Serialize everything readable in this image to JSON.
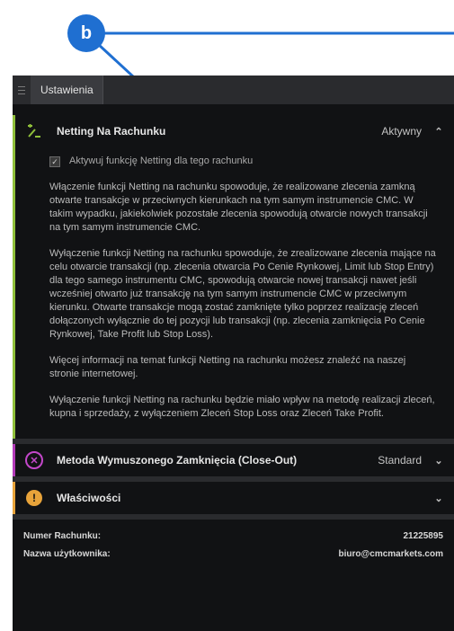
{
  "annotation": {
    "badge_label": "b"
  },
  "tabbar": {
    "tab_label": "Ustawienia"
  },
  "netting": {
    "title": "Netting Na Rachunku",
    "status": "Aktywny",
    "checkbox_label": "Aktywuj funkcję Netting dla tego rachunku",
    "checked": true,
    "paragraphs": [
      "Włączenie funkcji Netting na rachunku spowoduje, że realizowane zlecenia zamkną otwarte transakcje w przeciwnych kierunkach na tym samym instrumencie CMC. W takim wypadku, jakiekolwiek pozostałe zlecenia spowodują otwarcie nowych transakcji na tym samym instrumencie CMC.",
      "Wyłączenie funkcji Netting na rachunku spowoduje, że zrealizowane zlecenia mające na celu otwarcie transakcji (np. zlecenia otwarcia Po Cenie Rynkowej, Limit lub Stop Entry) dla tego samego instrumentu CMC, spowodują otwarcie nowej transakcji nawet jeśli wcześniej otwarto już transakcję na tym samym instrumencie CMC w przeciwnym kierunku. Otwarte transakcje mogą zostać zamknięte tylko poprzez realizację zleceń dołączonych wyłącznie do tej pozycji lub transakcji (np. zlecenia zamknięcia Po Cenie Rynkowej, Take Profit lub Stop Loss).",
      "Więcej informacji na temat funkcji Netting na rachunku możesz znaleźć na naszej stronie internetowej.",
      "Wyłączenie funkcji Netting na rachunku będzie miało wpływ na metodę realizacji zleceń, kupna i sprzedaży, z wyłączeniem Zleceń Stop Loss oraz Zleceń Take Profit."
    ]
  },
  "closeout": {
    "title": "Metoda Wymuszonego Zamknięcia (Close-Out)",
    "status": "Standard"
  },
  "properties": {
    "title": "Właściwości"
  },
  "footer": {
    "account_label": "Numer Rachunku:",
    "account_value": "21225895",
    "username_label": "Nazwa użytkownika:",
    "username_value": "biuro@cmcmarkets.com"
  },
  "colors": {
    "accent_green": "#8fbf3a",
    "accent_purple": "#b23ab8",
    "accent_orange": "#e8a33a",
    "badge_blue": "#1f6fd1"
  },
  "icons": [
    "netting-icon",
    "close-out-icon",
    "info-icon",
    "chevron-up-icon",
    "chevron-down-icon",
    "menu-icon",
    "checkmark-icon"
  ]
}
